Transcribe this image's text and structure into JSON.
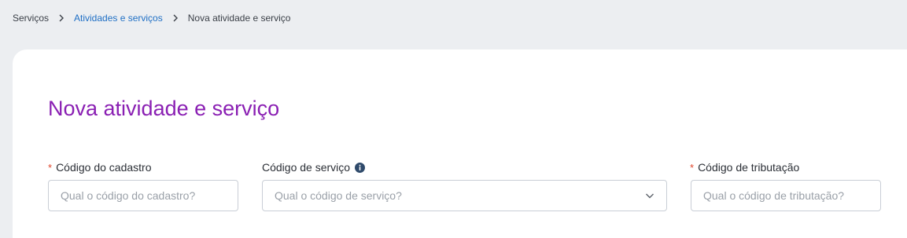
{
  "breadcrumb": {
    "items": [
      {
        "label": "Serviços"
      },
      {
        "label": "Atividades e serviços"
      },
      {
        "label": "Nova atividade e serviço"
      }
    ]
  },
  "colors": {
    "title": "#8a1fb3",
    "link": "#1f6fc5",
    "required_marker": "#e0452b",
    "info_icon": "#2f4a6b"
  },
  "page": {
    "title": "Nova atividade e serviço"
  },
  "form": {
    "fields": [
      {
        "label": "Código do cadastro",
        "required_marker": "*",
        "placeholder": "Qual o código do cadastro?",
        "value": ""
      },
      {
        "label": "Código de serviço",
        "icon": "info-icon",
        "placeholder": "Qual o código de serviço?",
        "dropdown_icon": "chevron-down-icon"
      },
      {
        "label": "Código de tributação",
        "required_marker": "*",
        "placeholder": "Qual o código de tributação?",
        "value": ""
      }
    ]
  }
}
